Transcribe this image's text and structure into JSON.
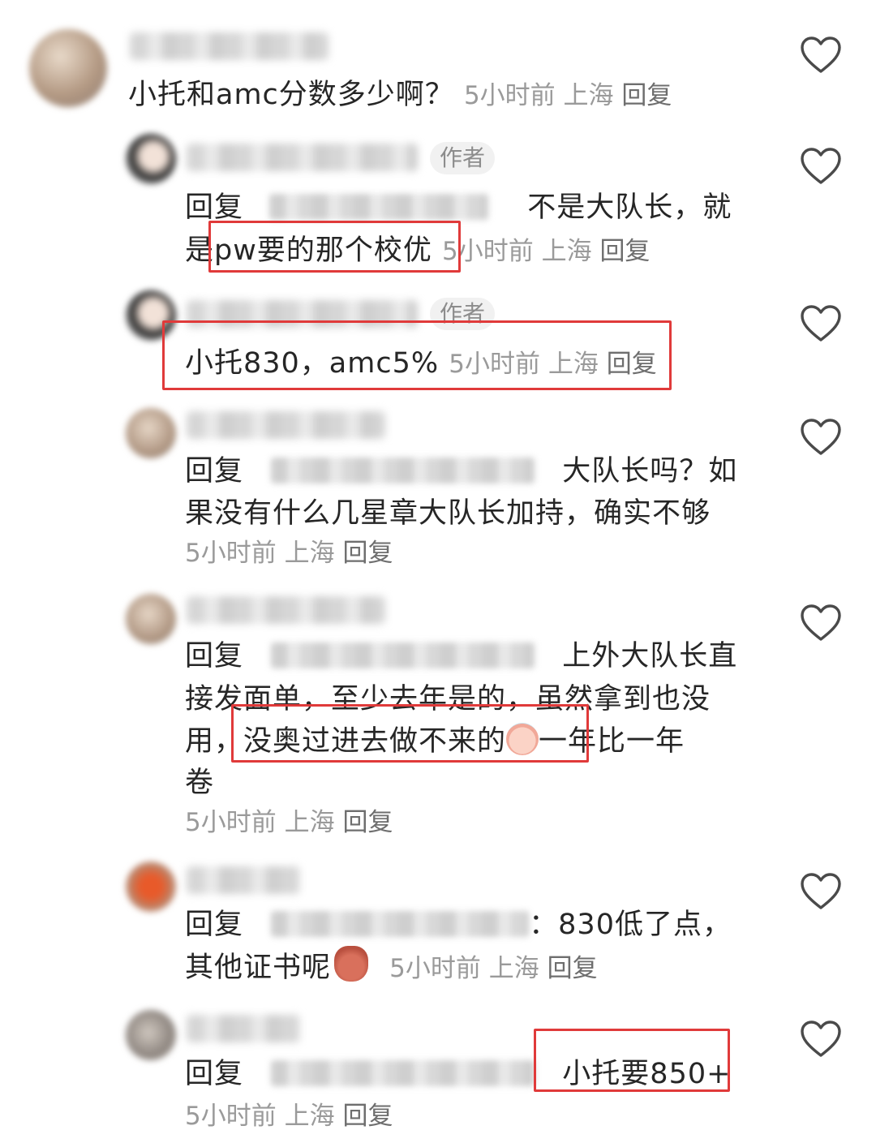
{
  "comments": [
    {
      "text": "小托和amc分数多少啊？",
      "time": "5小时前",
      "location": "上海",
      "reply_label": "回复"
    },
    {
      "author_tag": "作者",
      "reply_prefix": "回复",
      "text_line1": "不是大队长，就",
      "text_line2": "是pw要的那个校优",
      "time": "5小时前",
      "location": "上海",
      "reply_label": "回复"
    },
    {
      "author_tag": "作者",
      "text": "小托830，amc5%",
      "time": "5小时前",
      "location": "上海",
      "reply_label": "回复"
    },
    {
      "reply_prefix": "回复",
      "text_line1": "大队长吗？如",
      "text_line2": "果没有什么几星章大队长加持，确实不够",
      "time": "5小时前",
      "location": "上海",
      "reply_label": "回复"
    },
    {
      "reply_prefix": "回复",
      "text_line1": "上外大队长直",
      "text_line2": "接发面单，至少去年是的，虽然拿到也没",
      "text_line3_a": "用，",
      "text_line3_b": "没奥过进去做不来的",
      "text_line3_c": "一年比一年",
      "text_line4": "卷",
      "time": "5小时前",
      "location": "上海",
      "reply_label": "回复"
    },
    {
      "reply_prefix": "回复",
      "text_line1": "：830低了点，",
      "text_line2": "其他证书呢",
      "time": "5小时前",
      "location": "上海",
      "reply_label": "回复"
    },
    {
      "reply_prefix": "回复",
      "text": "小托要850+",
      "time": "5小时前",
      "location": "上海",
      "reply_label": "回复"
    }
  ],
  "colors": {
    "highlight": "#e03a3a",
    "meta": "#9a9a9a",
    "heart": "#4a4a4a"
  },
  "icons": {
    "like": "heart-outline-icon",
    "emoji_cry": "crying-face-emoji",
    "emoji_angry": "angry-bag-emoji"
  }
}
